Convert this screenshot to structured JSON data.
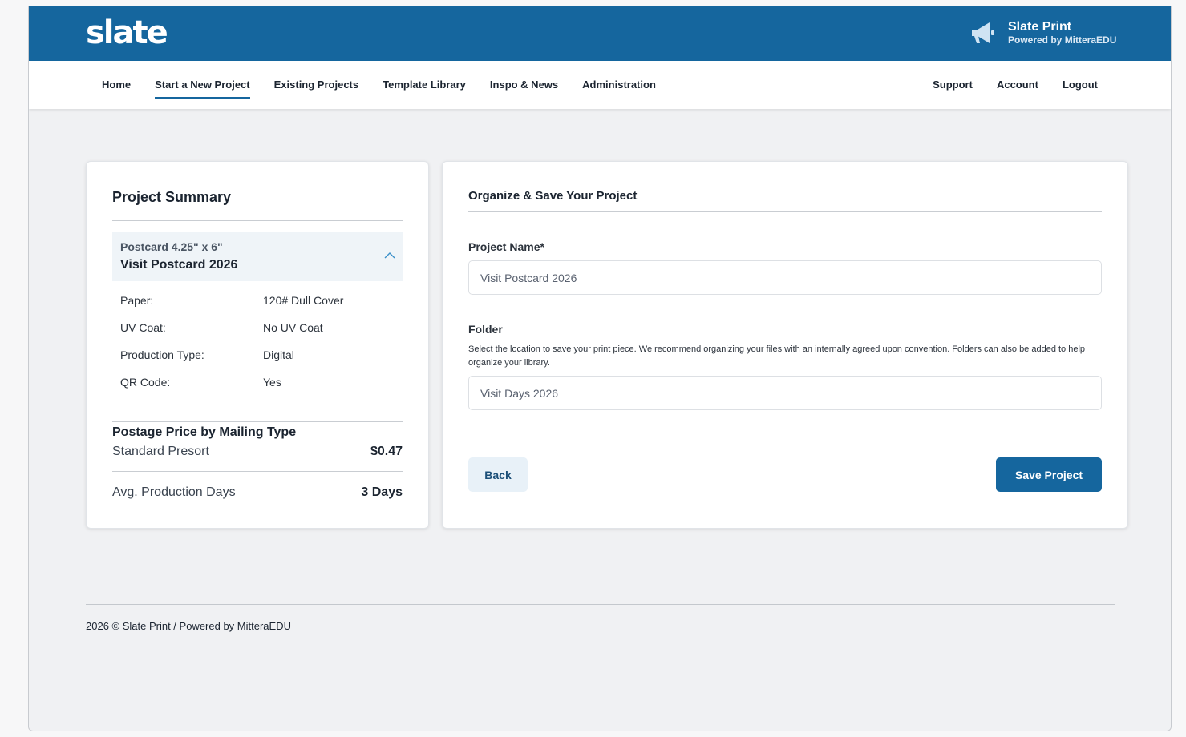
{
  "header": {
    "logo": "slate",
    "brand_title": "Slate Print",
    "brand_subtitle": "Powered by MitteraEDU"
  },
  "nav": {
    "left": [
      {
        "label": "Home"
      },
      {
        "label": "Start a New Project",
        "active": true
      },
      {
        "label": "Existing Projects"
      },
      {
        "label": "Template Library"
      },
      {
        "label": "Inspo & News"
      },
      {
        "label": "Administration"
      }
    ],
    "right": [
      {
        "label": "Support"
      },
      {
        "label": "Account"
      },
      {
        "label": "Logout"
      }
    ]
  },
  "summary": {
    "title": "Project Summary",
    "product": "Postcard 4.25\" x 6\"",
    "project_name": "Visit Postcard 2026",
    "specs": [
      {
        "label": "Paper:",
        "value": "120# Dull Cover"
      },
      {
        "label": "UV Coat:",
        "value": "No UV Coat"
      },
      {
        "label": "Production Type:",
        "value": "Digital"
      },
      {
        "label": "QR Code:",
        "value": "Yes"
      }
    ],
    "postage_title": "Postage Price by Mailing Type",
    "postage_label": "Standard Presort",
    "postage_price": "$0.47",
    "production_label": "Avg. Production Days",
    "production_value": "3 Days"
  },
  "form": {
    "title": "Organize & Save Your Project",
    "project_name_label": "Project Name*",
    "project_name_value": "Visit Postcard 2026",
    "folder_label": "Folder",
    "folder_help": "Select the location to save your print piece. We recommend organizing your files with an internally agreed upon convention. Folders can also be added to help organize your library.",
    "folder_value": "Visit Days 2026",
    "back_label": "Back",
    "save_label": "Save Project"
  },
  "footer": {
    "text": "2026 © Slate Print / Powered by MitteraEDU"
  },
  "colors": {
    "brand_blue": "#15669e",
    "background": "#f0f1f3"
  }
}
